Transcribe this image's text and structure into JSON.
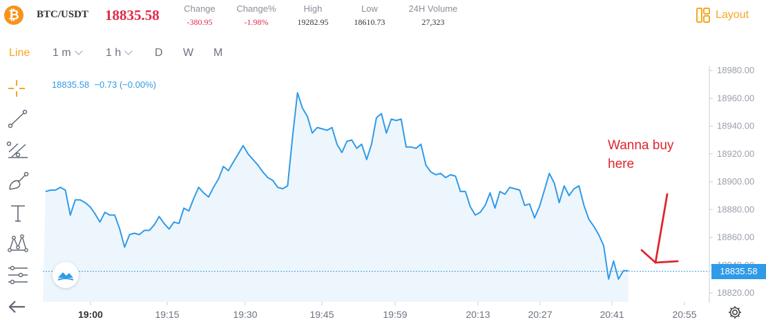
{
  "header": {
    "logo_glyph": "₿",
    "pair": "BTC/USDT",
    "last_price": "18835.58",
    "stats": [
      {
        "label": "Change",
        "value": "-380.95",
        "negative": true
      },
      {
        "label": "Change%",
        "value": "-1.98%",
        "negative": true
      },
      {
        "label": "High",
        "value": "19282.95",
        "negative": false
      },
      {
        "label": "Low",
        "value": "18610.73",
        "negative": false
      },
      {
        "label": "24H Volume",
        "value": "27,323",
        "negative": false
      }
    ],
    "layout_label": "Layout"
  },
  "toolbar": {
    "chart_type": "Line",
    "intervals": [
      {
        "label": "1 m",
        "has_dropdown": true
      },
      {
        "label": "1 h",
        "has_dropdown": true
      },
      {
        "label": "D",
        "has_dropdown": false
      },
      {
        "label": "W",
        "has_dropdown": false
      },
      {
        "label": "M",
        "has_dropdown": false
      }
    ]
  },
  "tools": [
    "crosshair-icon",
    "trend-line-icon",
    "fib-lines-icon",
    "brush-icon",
    "text-tool-icon",
    "pattern-icon",
    "measure-settings-icon",
    "back-arrow-icon"
  ],
  "legend": {
    "price": "18835.58",
    "change": "−0.73 (−0.00%)"
  },
  "annotation": {
    "line1": "Wanna buy",
    "line2": "here"
  },
  "price_tag": "18835.58",
  "colors": {
    "line": "#2f9ae8",
    "fill": "#eef6fd",
    "accent": "#f5a623",
    "negative": "#e0294a",
    "annotation": "#e0242c"
  },
  "chart_data": {
    "type": "area",
    "x_ticks": [
      "19:00",
      "19:15",
      "19:30",
      "19:45",
      "19:59",
      "20:13",
      "20:27",
      "20:41",
      "20:55"
    ],
    "y_ticks": [
      "18820.00",
      "18840.00",
      "18860.00",
      "18880.00",
      "18900.00",
      "18920.00",
      "18940.00",
      "18960.00",
      "18980.00"
    ],
    "ylim": [
      18814,
      18981
    ],
    "xlim": [
      0,
      121.27
    ],
    "current_price": 18835.58,
    "values": [
      18893,
      18894,
      18894,
      18896,
      18894,
      18876,
      18887,
      18887,
      18885,
      18882,
      18877,
      18871,
      18878,
      18876,
      18876,
      18866,
      18853,
      18862,
      18863,
      18862,
      18865,
      18865,
      18869,
      18875,
      18870,
      18866,
      18871,
      18870,
      18881,
      18879,
      18888,
      18896,
      18892,
      18889,
      18896,
      18902,
      18911,
      18908,
      18914,
      18920,
      18926,
      18920,
      18916,
      18912,
      18907,
      18903,
      18901,
      18896,
      18895,
      18897,
      18932,
      18964,
      18953,
      18947,
      18935,
      18939,
      18938,
      18937,
      18939,
      18927,
      18921,
      18929,
      18930,
      18924,
      18927,
      18916,
      18927,
      18946,
      18949,
      18935,
      18945,
      18944,
      18945,
      18925,
      18925,
      18924,
      18927,
      18912,
      18907,
      18905,
      18906,
      18903,
      18905,
      18904,
      18893,
      18893,
      18882,
      18876,
      18878,
      18883,
      18892,
      18881,
      18893,
      18891,
      18896,
      18895,
      18894,
      18883,
      18884,
      18874,
      18882,
      18894,
      18906,
      18899,
      18885,
      18897,
      18890,
      18895,
      18897,
      18883,
      18873,
      18868,
      18862,
      18854,
      18830,
      18843,
      18830,
      18836,
      18836
    ]
  }
}
